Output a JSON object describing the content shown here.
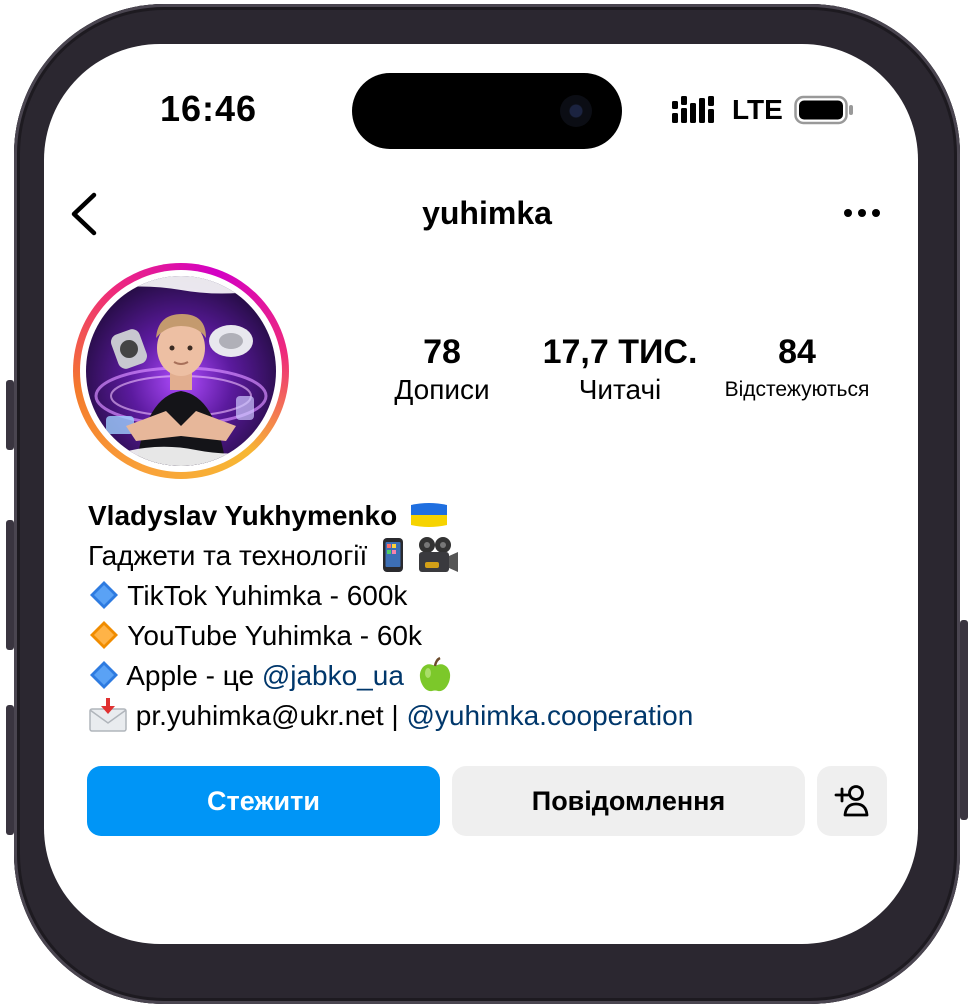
{
  "status_bar": {
    "time": "16:46",
    "network": "LTE"
  },
  "header": {
    "username": "yuhimka"
  },
  "stats": {
    "posts_count": "78",
    "posts_label": "Дописи",
    "followers_count": "17,7 ТИС.",
    "followers_label": "Читачі",
    "following_count": "84",
    "following_label": "Відстежуються"
  },
  "bio": {
    "name": "Vladyslav Yukhymenko",
    "line1": "Гаджети та технології",
    "line2": "TikTok Yuhimka - 600k",
    "line3": "YouTube Yuhimka - 60k",
    "line4_text": "Apple - це",
    "line4_link": "@jabko_ua",
    "line5_text": "pr.yuhimka@ukr.net |",
    "line5_link": "@yuhimka.cooperation"
  },
  "buttons": {
    "follow": "Стежити",
    "message": "Повідомлення"
  },
  "colors": {
    "accent": "#0095f6",
    "link": "#00376b",
    "secondary_button": "#efefef"
  },
  "icons": [
    "back-chevron-icon",
    "more-icon",
    "signal-icon",
    "battery-icon",
    "add-user-icon",
    "ukraine-flag-icon",
    "phone-emoji-icon",
    "camera-emoji-icon",
    "blue-diamond-icon",
    "orange-diamond-icon",
    "green-apple-icon",
    "envelope-icon"
  ]
}
